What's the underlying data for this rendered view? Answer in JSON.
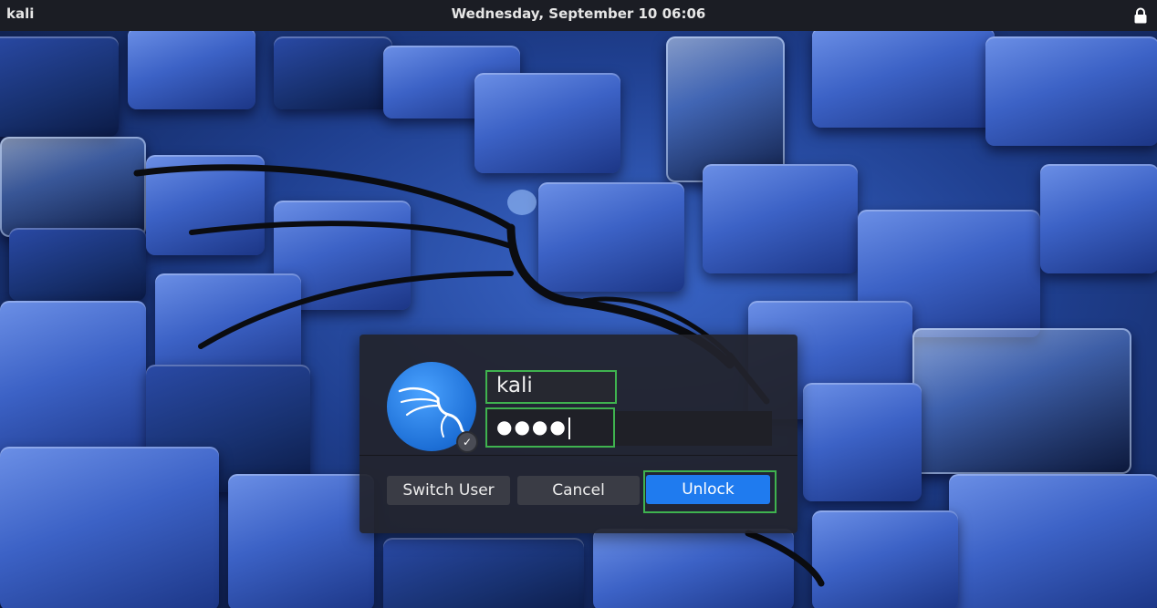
{
  "topbar": {
    "hostname": "kali",
    "datetime": "Wednesday, September 10  06:06",
    "lock_icon": "lock-icon"
  },
  "dialog": {
    "avatar_icon": "kali-dragon-icon",
    "badge_icon": "check-icon",
    "username": "kali",
    "password_mask": "●●●●",
    "buttons": {
      "switch_user": "Switch User",
      "cancel": "Cancel",
      "unlock": "Unlock"
    }
  },
  "colors": {
    "accent": "#1f7bef",
    "highlight": "#3fb34f",
    "panel": "#22242c",
    "topbar": "#1b1d24"
  }
}
